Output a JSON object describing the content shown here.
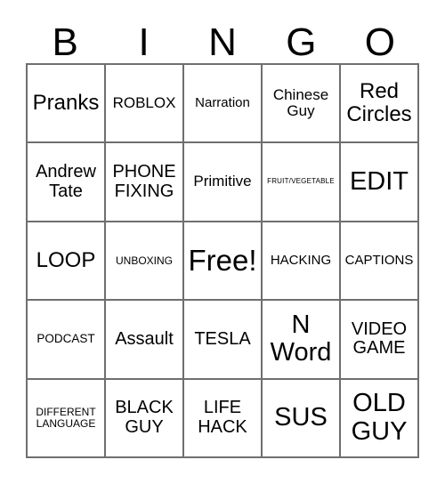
{
  "card": {
    "header_letters": [
      "B",
      "I",
      "N",
      "G",
      "O"
    ],
    "border_color": "#6f6f6f",
    "text_color": "#000000",
    "background_color": "#ffffff",
    "columns": 5,
    "rows": 5,
    "free_space_label": "Free!",
    "free_space_position": "center"
  },
  "cells": [
    {
      "text": "Pranks",
      "size": "xl"
    },
    {
      "text": "ROBLOX",
      "size": "ml"
    },
    {
      "text": "Narration",
      "size": "m"
    },
    {
      "text": "Chinese\nGuy",
      "size": "ml"
    },
    {
      "text": "Red\nCircles",
      "size": "xl"
    },
    {
      "text": "Andrew\nTate",
      "size": "l"
    },
    {
      "text": "PHONE\nFIXING",
      "size": "l"
    },
    {
      "text": "Primitive",
      "size": "ml"
    },
    {
      "text": "FRUIT/VEGETABLE",
      "size": "xs"
    },
    {
      "text": "EDIT",
      "size": "xxl"
    },
    {
      "text": "LOOP",
      "size": "xl"
    },
    {
      "text": "UNBOXING",
      "size": "s"
    },
    {
      "text": "Free!",
      "size": "huge"
    },
    {
      "text": "HACKING",
      "size": "m"
    },
    {
      "text": "CAPTIONS",
      "size": "m"
    },
    {
      "text": "PODCAST",
      "size": "sm"
    },
    {
      "text": "Assault",
      "size": "l"
    },
    {
      "text": "TESLA",
      "size": "l"
    },
    {
      "text": "N\nWord",
      "size": "xxl"
    },
    {
      "text": "VIDEO\nGAME",
      "size": "l"
    },
    {
      "text": "DIFFERENT\nLANGUAGE",
      "size": "s"
    },
    {
      "text": "BLACK\nGUY",
      "size": "l"
    },
    {
      "text": "LIFE\nHACK",
      "size": "l"
    },
    {
      "text": "SUS",
      "size": "xxl"
    },
    {
      "text": "OLD\nGUY",
      "size": "xxl"
    }
  ]
}
